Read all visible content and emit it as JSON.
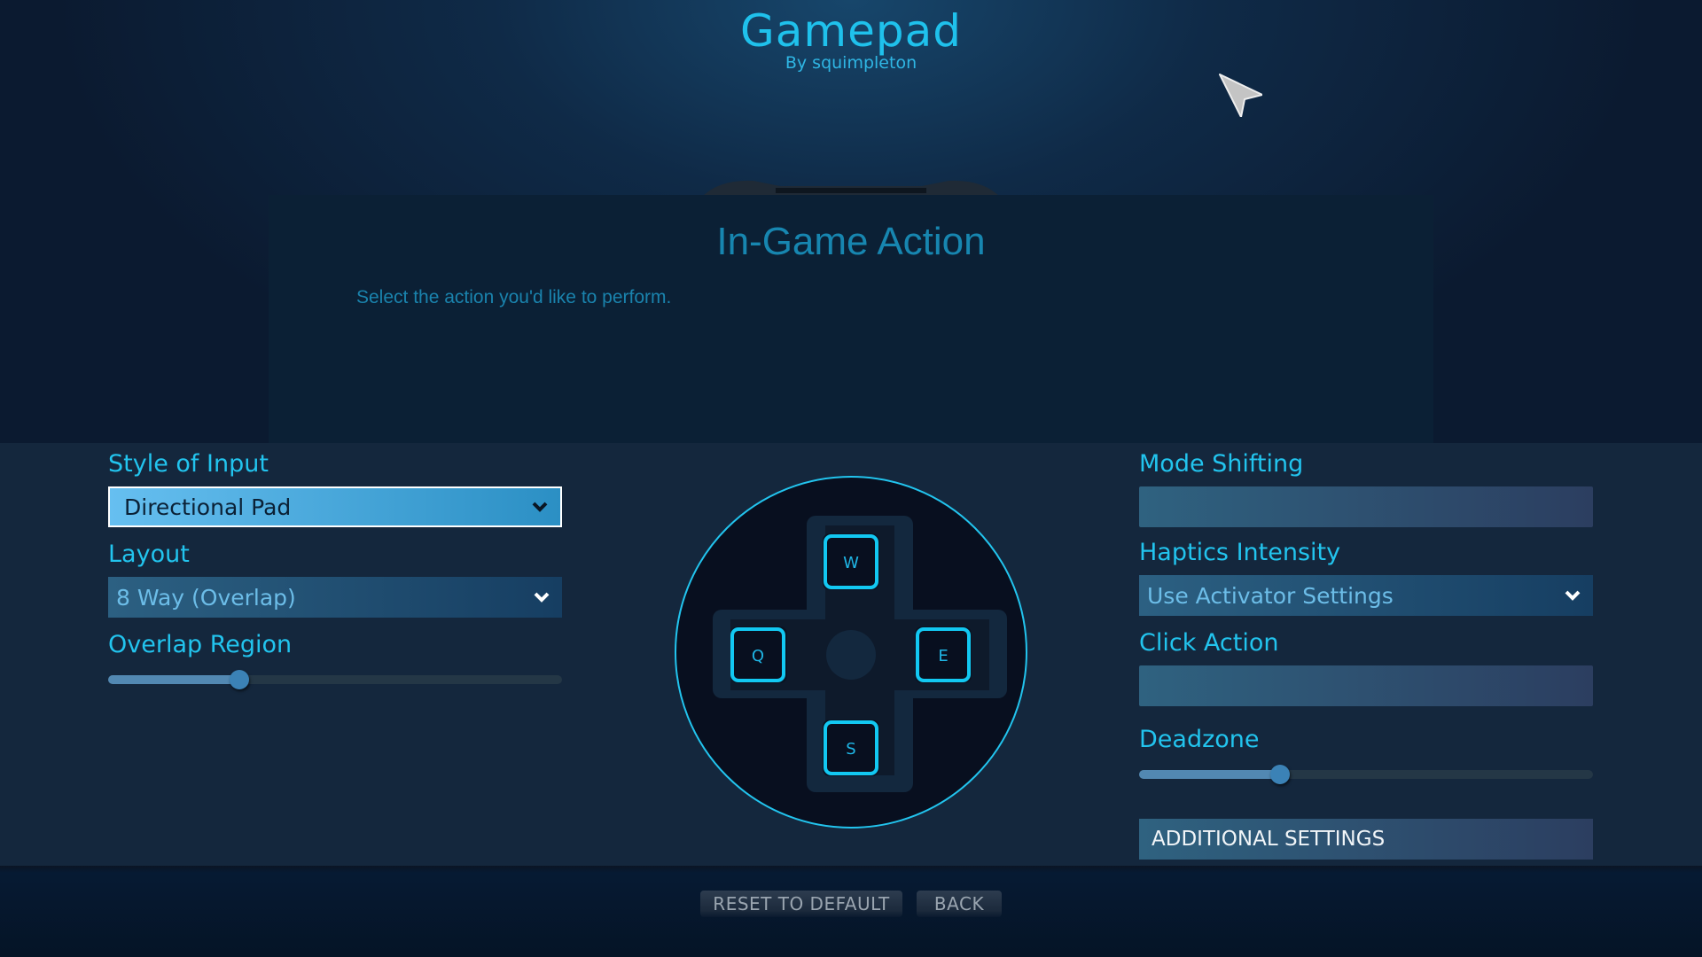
{
  "header": {
    "title": "Gamepad",
    "subtitle": "By squimpleton"
  },
  "dialog": {
    "title": "In-Game Action",
    "description": "Select the action you'd like to perform."
  },
  "left": {
    "style_of_input": {
      "label": "Style of Input",
      "value": "Directional Pad"
    },
    "layout": {
      "label": "Layout",
      "value": "8 Way (Overlap)"
    },
    "overlap_region": {
      "label": "Overlap Region",
      "value_fraction": 0.29
    }
  },
  "dpad": {
    "icon": "dpad-icon",
    "keys": {
      "up": "W",
      "left": "Q",
      "right": "E",
      "down": "S"
    }
  },
  "right": {
    "mode_shifting": {
      "label": "Mode Shifting",
      "value": ""
    },
    "haptics_intensity": {
      "label": "Haptics Intensity",
      "value": "Use Activator Settings"
    },
    "click_action": {
      "label": "Click Action",
      "value": ""
    },
    "deadzone": {
      "label": "Deadzone",
      "value_fraction": 0.31
    },
    "additional_settings": "ADDITIONAL SETTINGS"
  },
  "footer": {
    "reset_label": "RESET TO DEFAULT",
    "back_label": "BACK"
  },
  "colors": {
    "accent": "#22c4ee",
    "panel": "#0b2035",
    "main_bg": "#14273d"
  }
}
